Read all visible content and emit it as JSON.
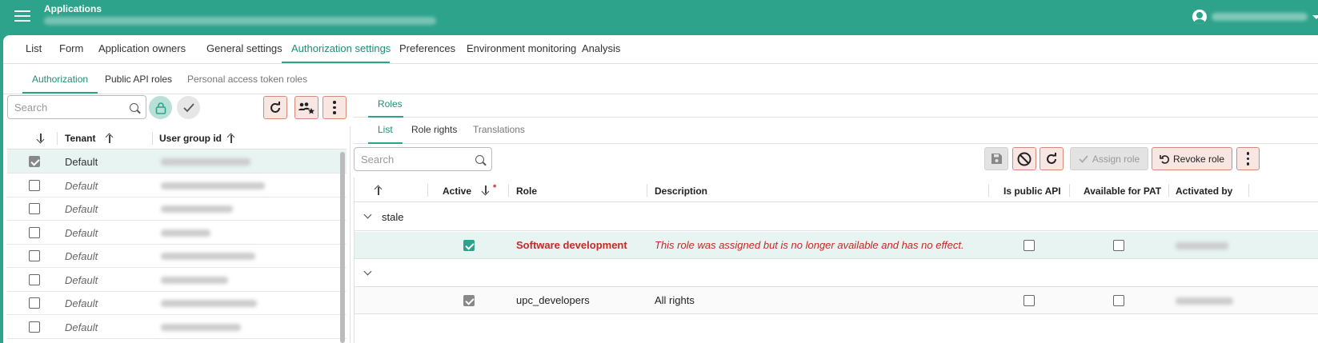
{
  "header": {
    "title": "Applications"
  },
  "main_tabs": [
    "List",
    "Form",
    "Application owners",
    "General settings",
    "Authorization settings",
    "Preferences",
    "Environment monitoring",
    "Analysis"
  ],
  "sub_tabs": [
    "Authorization",
    "Public API roles",
    "Personal access token roles"
  ],
  "left": {
    "search_placeholder": "Search",
    "columns": {
      "tenant": "Tenant",
      "user_group": "User group id"
    },
    "rows": [
      {
        "tenant": "Default",
        "selected": true
      },
      {
        "tenant": "Default",
        "selected": false
      },
      {
        "tenant": "Default",
        "selected": false
      },
      {
        "tenant": "Default",
        "selected": false
      },
      {
        "tenant": "Default",
        "selected": false
      },
      {
        "tenant": "Default",
        "selected": false
      },
      {
        "tenant": "Default",
        "selected": false
      },
      {
        "tenant": "Default",
        "selected": false
      }
    ]
  },
  "roles": {
    "tab": "Roles",
    "sub_tabs": [
      "List",
      "Role rights",
      "Translations"
    ],
    "search_placeholder": "Search",
    "assign_label": "Assign role",
    "revoke_label": "Revoke role",
    "columns": {
      "active": "Active",
      "required_mark": "*",
      "role": "Role",
      "description": "Description",
      "public_api": "Is public API",
      "pat": "Available for PAT",
      "activated_by": "Activated by"
    },
    "groups": [
      {
        "label": "stale",
        "row": {
          "role": "Software development",
          "description": "This role was assigned but is no longer available and has no effect.",
          "active": true
        }
      },
      {
        "label": "",
        "row": {
          "role": "upc_developers",
          "description": "All rights",
          "active": true
        }
      }
    ]
  },
  "colors": {
    "brand": "#2ea38b",
    "error": "#c62828"
  }
}
